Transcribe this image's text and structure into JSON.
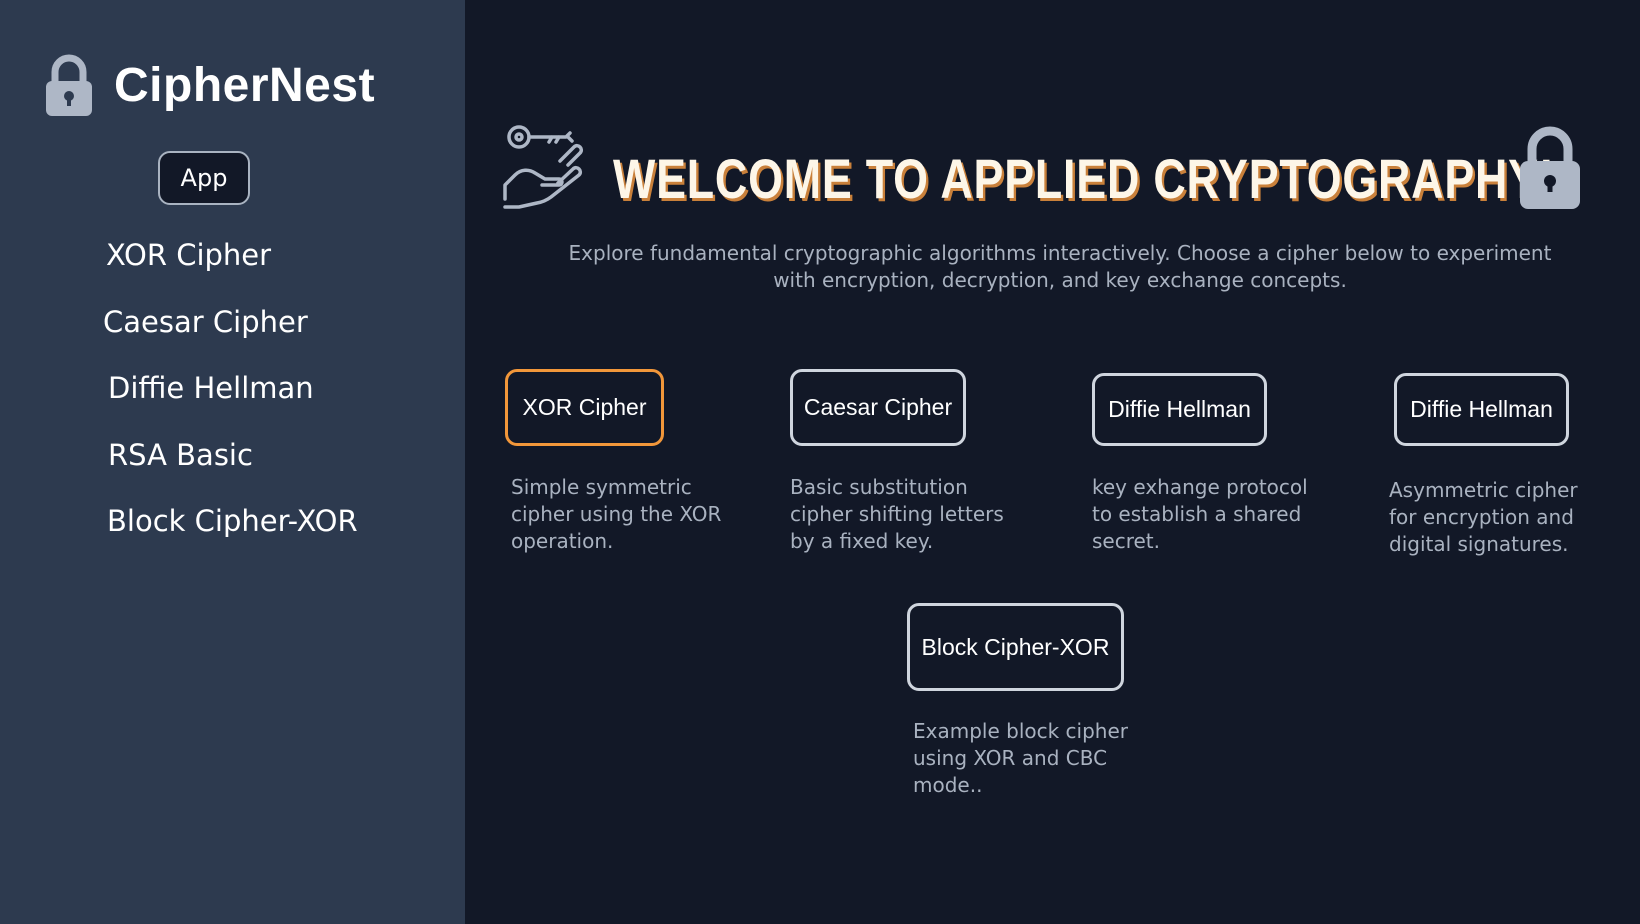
{
  "sidebar": {
    "brand": "CipherNest",
    "app_button": "App",
    "items": [
      {
        "label": "XOR Cipher"
      },
      {
        "label": "Caesar Cipher"
      },
      {
        "label": "Diffie Hellman"
      },
      {
        "label": "RSA Basic"
      },
      {
        "label": "Block Cipher-XOR"
      }
    ]
  },
  "main": {
    "title": "WELCOME TO APPLIED CRYPTOGRAPHY!",
    "subtitle": "Explore fundamental cryptographic algorithms interactively. Choose a cipher below to experiment with encryption, decryption, and key exchange concepts.",
    "cards": [
      {
        "label": "XOR Cipher",
        "description": "Simple symmetric cipher using the XOR operation.",
        "active": true
      },
      {
        "label": "Caesar Cipher",
        "description": "Basic substitution cipher shifting letters by a fixed key."
      },
      {
        "label": "Diffie Hellman",
        "description": "key exhange protocol to establish a shared secret."
      },
      {
        "label": "Diffie Hellman",
        "description": "Asymmetric cipher for encryption and digital signatures."
      },
      {
        "label": "Block Cipher-XOR",
        "description": "Example block cipher using XOR and CBC mode.."
      }
    ]
  },
  "colors": {
    "sidebar_bg": "#2d3a4f",
    "main_bg": "#121827",
    "accent": "#f2973a",
    "title_shadow": "#c9803a"
  },
  "icons": [
    "lock-icon",
    "key-hand-icon",
    "lock-icon"
  ]
}
